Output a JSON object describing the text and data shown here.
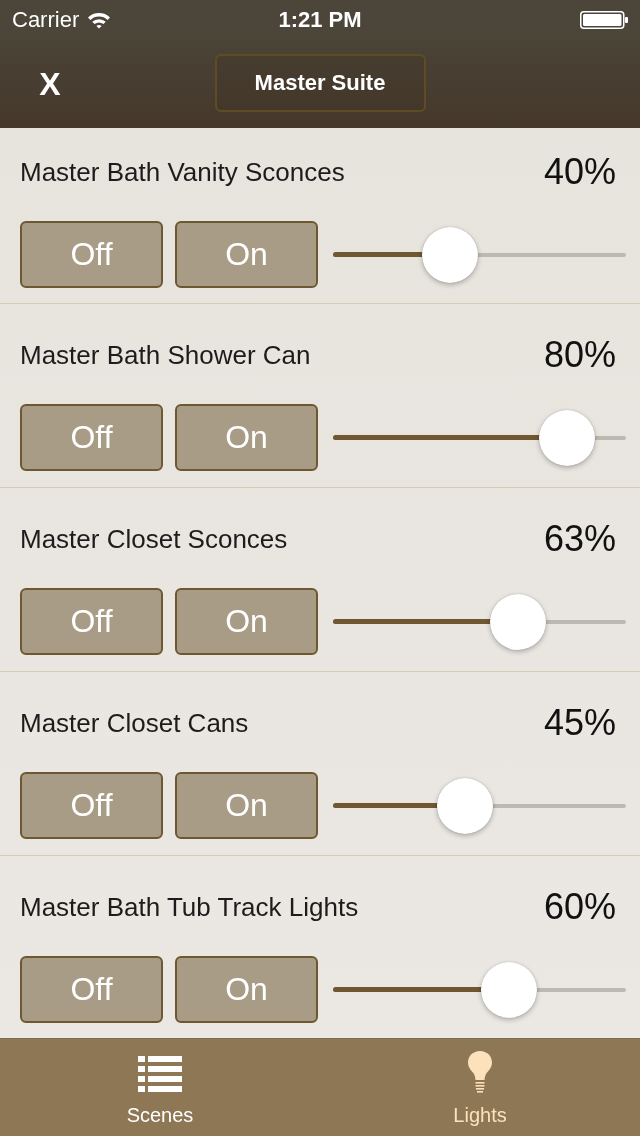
{
  "status_bar": {
    "carrier": "Carrier",
    "time": "1:21 PM"
  },
  "nav_bar": {
    "close_label": "X",
    "title": "Master Suite"
  },
  "lights": [
    {
      "name": "Master Bath Vanity Sconces",
      "reading": "40%",
      "level": 0.4,
      "off_label": "Off",
      "on_label": "On"
    },
    {
      "name": "Master Bath Shower Can",
      "reading": "80%",
      "level": 0.8,
      "off_label": "Off",
      "on_label": "On"
    },
    {
      "name": "Master Closet Sconces",
      "reading": "63%",
      "level": 0.63,
      "off_label": "Off",
      "on_label": "On"
    },
    {
      "name": "Master Closet Cans",
      "reading": "45%",
      "level": 0.45,
      "off_label": "Off",
      "on_label": "On"
    },
    {
      "name": "Master Bath Tub Track Lights",
      "reading": "60%",
      "level": 0.6,
      "off_label": "Off",
      "on_label": "On"
    }
  ],
  "tab_bar": {
    "tabs": [
      {
        "label": "Scenes",
        "kind": "list",
        "selected": false
      },
      {
        "label": "Lights",
        "kind": "bulb",
        "selected": true
      }
    ]
  }
}
